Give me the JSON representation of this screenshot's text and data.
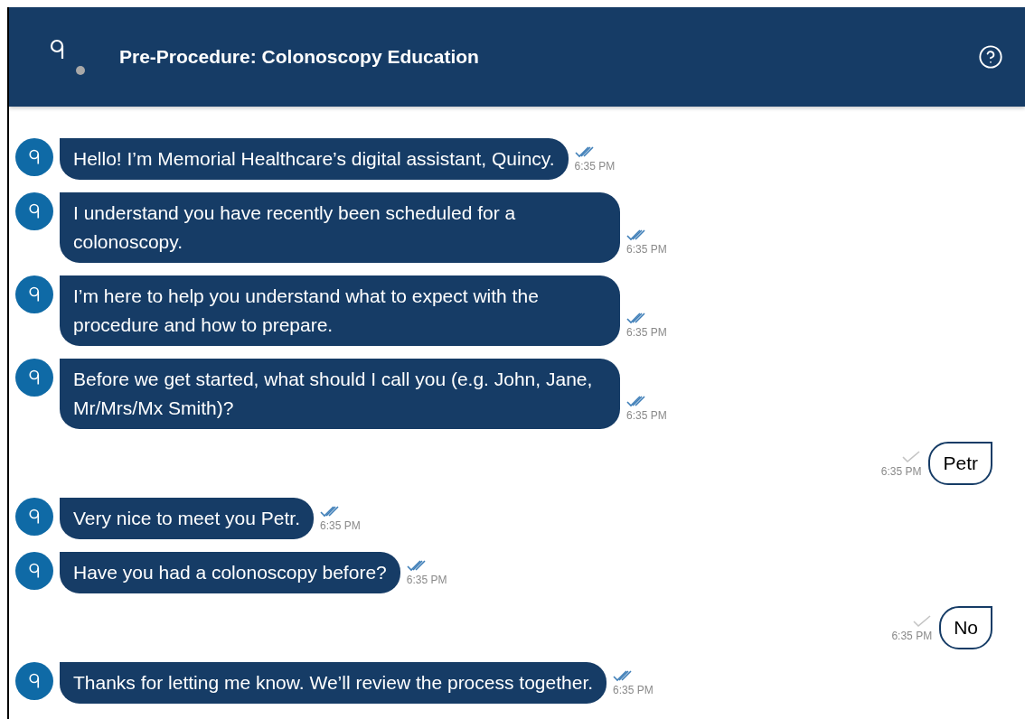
{
  "header": {
    "title": "Pre-Procedure: Colonoscopy Education"
  },
  "messages": [
    {
      "kind": "bot",
      "text": "Hello! I’m Memorial Healthcare’s digital assistant, Quincy.",
      "time": "6:35 PM",
      "read": true
    },
    {
      "kind": "bot",
      "text": "I understand you have recently been scheduled for a colonoscopy.",
      "time": "6:35 PM",
      "read": true
    },
    {
      "kind": "bot",
      "text": "I’m here to help you understand what to expect with the procedure and how to prepare.",
      "time": "6:35 PM",
      "read": true
    },
    {
      "kind": "bot",
      "text": "Before we get started, what should I call you (e.g. John, Jane, Mr/Mrs/Mx Smith)?",
      "time": "6:35 PM",
      "read": true
    },
    {
      "kind": "user",
      "text": "Petr",
      "time": "6:35 PM",
      "read": false
    },
    {
      "kind": "bot",
      "text": "Very nice to meet you Petr.",
      "time": "6:35 PM",
      "read": true
    },
    {
      "kind": "bot",
      "text": "Have you had a colonoscopy before?",
      "time": "6:35 PM",
      "read": true
    },
    {
      "kind": "user",
      "text": "No",
      "time": "6:35 PM",
      "read": false
    },
    {
      "kind": "bot",
      "text": "Thanks for letting me know. We’ll review the process together.",
      "time": "6:35 PM",
      "read": true
    }
  ]
}
